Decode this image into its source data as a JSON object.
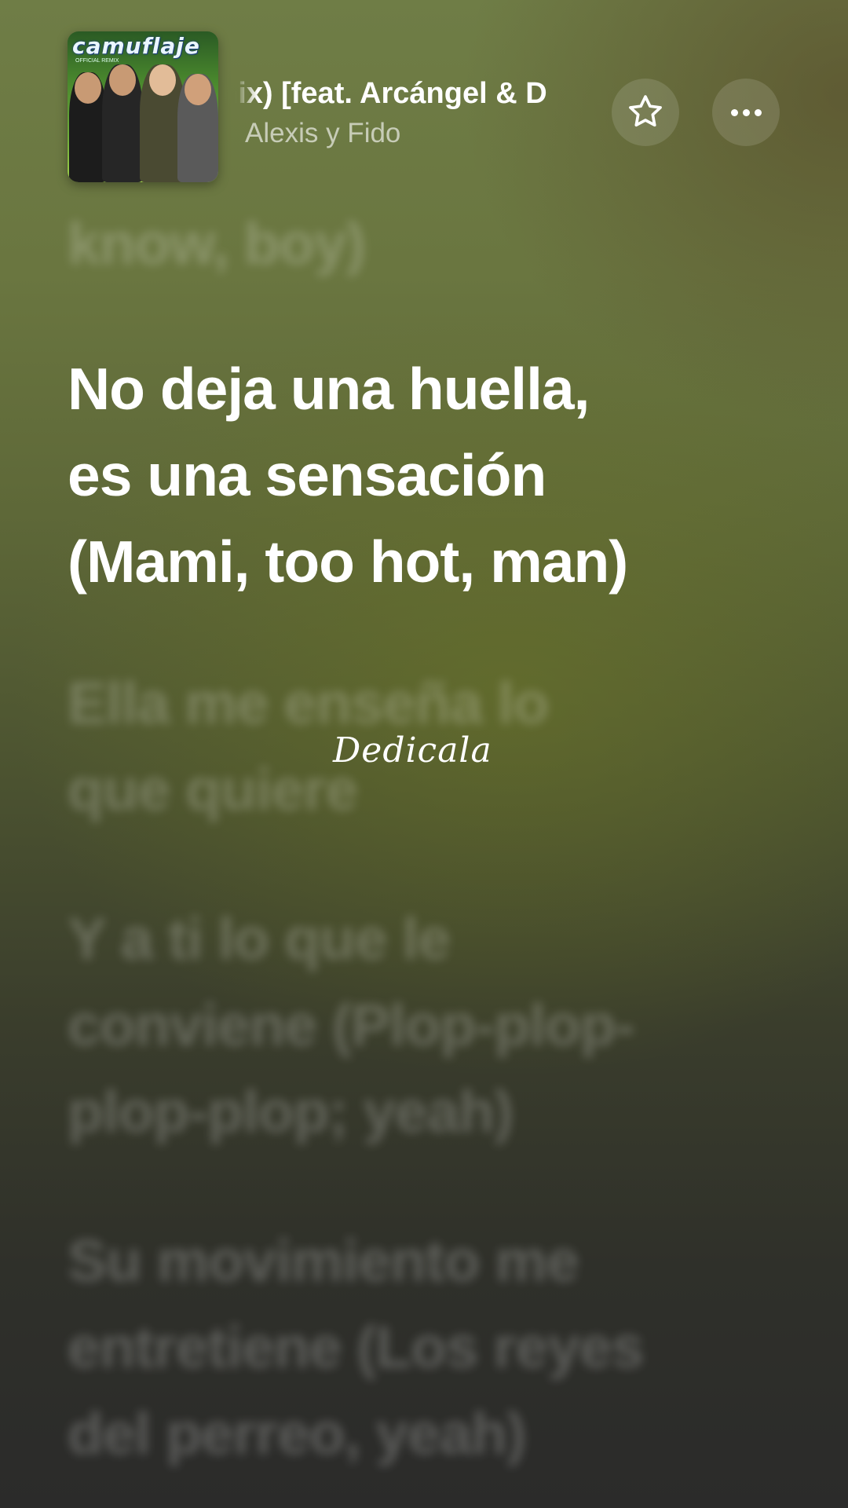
{
  "now_playing": {
    "title": "(Remix) [feat. Arcángel & De La Ghetto]",
    "title_visible": "nix) [feat. Arcángel & D",
    "artist": "Alexis y Fido",
    "album_art_text": "camuflaje",
    "album_art_subtext": "OFFICIAL REMIX"
  },
  "controls": {
    "favorite_icon": "star-outline-icon",
    "more_icon": "ellipsis-icon"
  },
  "lyrics": {
    "previous": [
      "know, boy)"
    ],
    "current": [
      "No deja una huella,",
      "es una sensación",
      "(Mami, too hot, man)"
    ],
    "next": [
      [
        "Ella me enseña lo",
        "que quiere"
      ],
      [
        "Y a ti lo que le",
        "conviene (Plop-plop-",
        "plop-plop; yeah)"
      ],
      [
        "Su movimiento me",
        "entretiene (Los reyes",
        "del perreo, yeah)"
      ]
    ]
  },
  "overlay": {
    "text": "Dedicala"
  }
}
